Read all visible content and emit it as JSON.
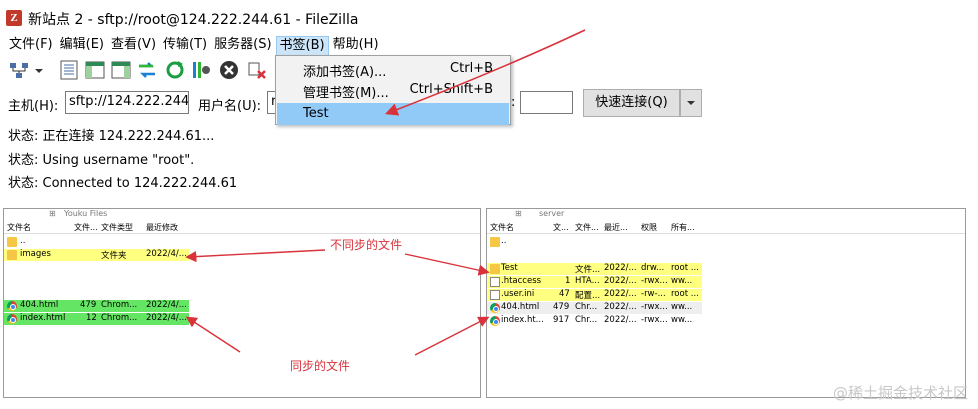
{
  "title": "新站点 2 - sftp://root@124.222.244.61 - FileZilla",
  "menu": [
    "文件(F)",
    "编辑(E)",
    "查看(V)",
    "传输(T)",
    "服务器(S)",
    "书签(B)",
    "帮助(H)"
  ],
  "bookmarks_menu": {
    "items": [
      {
        "label": "添加书签(A)...",
        "shortcut": "Ctrl+B"
      },
      {
        "label": "管理书签(M)...",
        "shortcut": "Ctrl+Shift+B"
      },
      {
        "label": "Test",
        "shortcut": ""
      }
    ]
  },
  "quickconnect": {
    "host_label": "主机(H):",
    "host_value": "sftp://124.222.244.",
    "user_label": "用户名(U):",
    "user_value": "r",
    "port_label": ":",
    "port_value": "",
    "connect_label": "快速连接(Q)"
  },
  "log": [
    "状态: 正在连接 124.222.244.61...",
    "状态: Using username \"root\".",
    "状态: Connected to 124.222.244.61"
  ],
  "local": {
    "path_node": "Youku Files",
    "headers": [
      "文件名",
      "文件...",
      "文件类型",
      "最近修改"
    ],
    "rows": [
      {
        "name": "..",
        "size": "",
        "type": "",
        "modified": "",
        "icon": "folder-icon",
        "highlight": ""
      },
      {
        "name": "images",
        "size": "",
        "type": "文件夹",
        "modified": "2022/4/...",
        "icon": "folder-icon",
        "highlight": "yellow"
      },
      {
        "name": "404.html",
        "size": "479",
        "type": "Chrom...",
        "modified": "2022/4/...",
        "icon": "chrome-icon",
        "highlight": "green"
      },
      {
        "name": "index.html",
        "size": "12",
        "type": "Chrom...",
        "modified": "2022/4/...",
        "icon": "chrome-icon",
        "highlight": "green"
      }
    ]
  },
  "remote": {
    "path_node": "server",
    "headers": [
      "文件名",
      "文...",
      "文件...",
      "最近...",
      "权限",
      "所有..."
    ],
    "rows": [
      {
        "name": "..",
        "size": "",
        "type": "",
        "modified": "",
        "perm": "",
        "owner": "",
        "icon": "folder-icon",
        "highlight": ""
      },
      {
        "name": "Test",
        "size": "",
        "type": "文件...",
        "modified": "2022/...",
        "perm": "drw...",
        "owner": "root ...",
        "icon": "folder-icon",
        "highlight": "yellow"
      },
      {
        "name": ".htaccess",
        "size": "1",
        "type": "HTA...",
        "modified": "2022/...",
        "perm": "-rwx...",
        "owner": "ww...",
        "icon": "document-icon",
        "highlight": "yellow"
      },
      {
        "name": ".user.ini",
        "size": "47",
        "type": "配置...",
        "modified": "2022/...",
        "perm": "-rw-...",
        "owner": "root ...",
        "icon": "document-icon",
        "highlight": "yellow"
      },
      {
        "name": "404.html",
        "size": "479",
        "type": "Chr...",
        "modified": "2022/...",
        "perm": "-rwx...",
        "owner": "ww...",
        "icon": "chrome-icon",
        "highlight": "gray"
      },
      {
        "name": "index.ht...",
        "size": "917",
        "type": "Chr...",
        "modified": "2022/...",
        "perm": "-rwx...",
        "owner": "ww...",
        "icon": "chrome-icon",
        "highlight": ""
      }
    ]
  },
  "annotations": {
    "unsynced": "不同步的文件",
    "synced": "同步的文件"
  },
  "watermark": "@稀土掘金技术社区",
  "colors": {
    "highlight_yellow": "#ffff80",
    "highlight_green": "#64e664",
    "annotation_red": "#d9323b",
    "menu_selected": "#91c9f7"
  }
}
